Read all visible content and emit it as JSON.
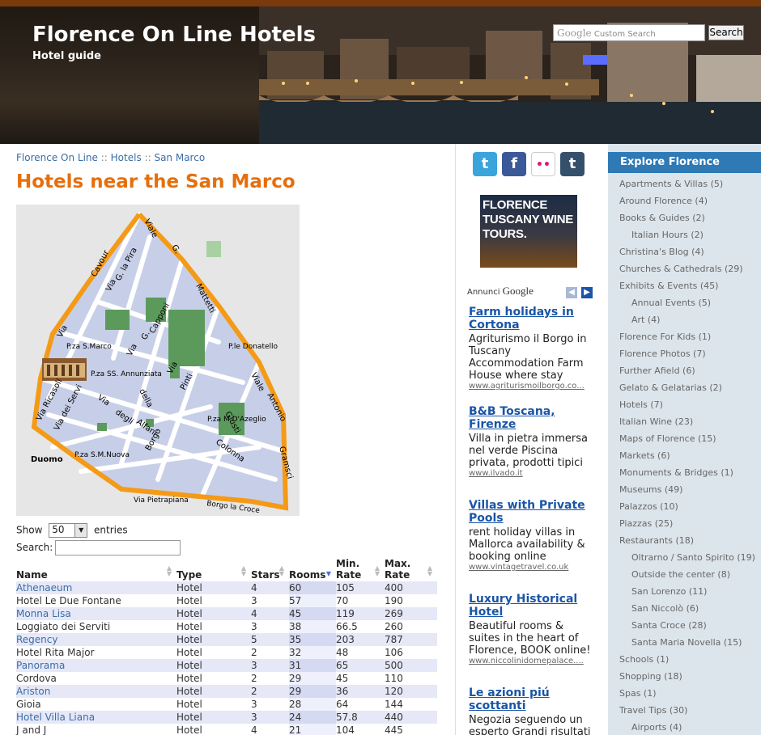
{
  "header": {
    "title": "Florence On Line Hotels",
    "subtitle": "Hotel guide",
    "search_logo": "Google",
    "search_placeholder": "Custom Search",
    "search_button": "Search"
  },
  "breadcrumb": {
    "home": "Florence On Line",
    "sep1": "::",
    "section": "Hotels",
    "sep2": "::",
    "current": "San Marco"
  },
  "page_title": "Hotels near the San Marco",
  "map": {
    "labels": [
      "Viale",
      "G.",
      "Mattetti",
      "Cavour",
      "Via",
      "G. la Pira",
      "Via",
      "P.za S.Marco",
      "Via",
      "G.",
      "Capponi",
      "P.le Donatello",
      "Viale",
      "Antonio",
      "P.za SS. Annunziata",
      "Via",
      "della",
      "Pinti",
      "Via Ricasoli",
      "Via dei Servi",
      "Via",
      "degli",
      "Alfani",
      "Borgo",
      "Giusti",
      "P.za M.D'Azeglio",
      "Colonna",
      "Gramsci",
      "Duomo",
      "P.za S.M.Nuova",
      "Via Pietrapiana",
      "Borgo la Croce"
    ]
  },
  "table_controls": {
    "show_label": "Show",
    "page_size": "50",
    "entries_label": "entries",
    "search_label": "Search:"
  },
  "table": {
    "columns": [
      "Name",
      "Type",
      "Stars",
      "Rooms",
      "Min. Rate",
      "Max. Rate"
    ],
    "rows": [
      [
        "Athenaeum",
        "Hotel",
        "4",
        "60",
        "105",
        "400"
      ],
      [
        "Hotel Le Due Fontane",
        "Hotel",
        "3",
        "57",
        "70",
        "190"
      ],
      [
        "Monna Lisa",
        "Hotel",
        "4",
        "45",
        "119",
        "269"
      ],
      [
        "Loggiato dei Serviti",
        "Hotel",
        "3",
        "38",
        "66.5",
        "260"
      ],
      [
        "Regency",
        "Hotel",
        "5",
        "35",
        "203",
        "787"
      ],
      [
        "Hotel Rita Major",
        "Hotel",
        "2",
        "32",
        "48",
        "106"
      ],
      [
        "Panorama",
        "Hotel",
        "3",
        "31",
        "65",
        "500"
      ],
      [
        "Cordova",
        "Hotel",
        "2",
        "29",
        "45",
        "110"
      ],
      [
        "Ariston",
        "Hotel",
        "2",
        "29",
        "36",
        "120"
      ],
      [
        "Gioia",
        "Hotel",
        "3",
        "28",
        "64",
        "144"
      ],
      [
        "Hotel Villa Liana",
        "Hotel",
        "3",
        "24",
        "57.8",
        "440"
      ],
      [
        "J and J",
        "Hotel",
        "4",
        "21",
        "104",
        "445"
      ]
    ]
  },
  "social": {
    "twitter": "t",
    "facebook": "f",
    "flickr": "••",
    "tumblr": "t"
  },
  "banner": {
    "line1": "FLORENCE",
    "line2": "TUSCANY WINE",
    "line3": "TOURS."
  },
  "ads": {
    "label": "Annunci",
    "label_brand": "Google",
    "items": [
      {
        "title": "Farm holidays in Cortona",
        "desc": "Agriturismo il Borgo in Tuscany Accommodation Farm House where stay",
        "url": "www.agriturismoilborgo.co..."
      },
      {
        "title": "B&B Toscana, Firenze",
        "desc": "Villa in pietra immersa nel verde Piscina privata, prodotti tipici",
        "url": "www.ilvado.it"
      },
      {
        "title": "Villas with Private Pools",
        "desc": "rent holiday villas in Mallorca availability & booking online",
        "url": "www.vintagetravel.co.uk"
      },
      {
        "title": "Luxury Historical Hotel",
        "desc": "Beautiful rooms & suites in the heart of Florence, BOOK online!",
        "url": "www.niccolinidomepalace...."
      },
      {
        "title": "Le azioni piú scottanti",
        "desc": "Negozia seguendo un esperto Grandi risultati",
        "url": ""
      }
    ]
  },
  "sidebar": {
    "heading": "Explore Florence",
    "items": [
      {
        "label": "Apartments & Villas (5)",
        "sub": false
      },
      {
        "label": "Around Florence (4)",
        "sub": false
      },
      {
        "label": "Books & Guides (2)",
        "sub": false
      },
      {
        "label": "Italian Hours (2)",
        "sub": true
      },
      {
        "label": "Christina's Blog (4)",
        "sub": false
      },
      {
        "label": "Churches & Cathedrals (29)",
        "sub": false
      },
      {
        "label": "Exhibits & Events (45)",
        "sub": false
      },
      {
        "label": "Annual Events (5)",
        "sub": true
      },
      {
        "label": "Art (4)",
        "sub": true
      },
      {
        "label": "Florence For Kids (1)",
        "sub": false
      },
      {
        "label": "Florence Photos (7)",
        "sub": false
      },
      {
        "label": "Further Afield (6)",
        "sub": false
      },
      {
        "label": "Gelato & Gelatarias (2)",
        "sub": false
      },
      {
        "label": "Hotels (7)",
        "sub": false
      },
      {
        "label": "Italian Wine (23)",
        "sub": false
      },
      {
        "label": "Maps of Florence (15)",
        "sub": false
      },
      {
        "label": "Markets (6)",
        "sub": false
      },
      {
        "label": "Monuments & Bridges (1)",
        "sub": false
      },
      {
        "label": "Museums (49)",
        "sub": false
      },
      {
        "label": "Palazzos (10)",
        "sub": false
      },
      {
        "label": "Piazzas (25)",
        "sub": false
      },
      {
        "label": "Restaurants (18)",
        "sub": false
      },
      {
        "label": "Oltrarno / Santo Spirito (19)",
        "sub": true
      },
      {
        "label": "Outside the center (8)",
        "sub": true
      },
      {
        "label": "San Lorenzo (11)",
        "sub": true
      },
      {
        "label": "San Niccolò (6)",
        "sub": true
      },
      {
        "label": "Santa Croce (28)",
        "sub": true
      },
      {
        "label": "Santa Maria Novella (15)",
        "sub": true
      },
      {
        "label": "Schools (1)",
        "sub": false
      },
      {
        "label": "Shopping (18)",
        "sub": false
      },
      {
        "label": "Spas (1)",
        "sub": false
      },
      {
        "label": "Travel Tips (30)",
        "sub": false
      },
      {
        "label": "Airports (4)",
        "sub": true
      }
    ]
  }
}
